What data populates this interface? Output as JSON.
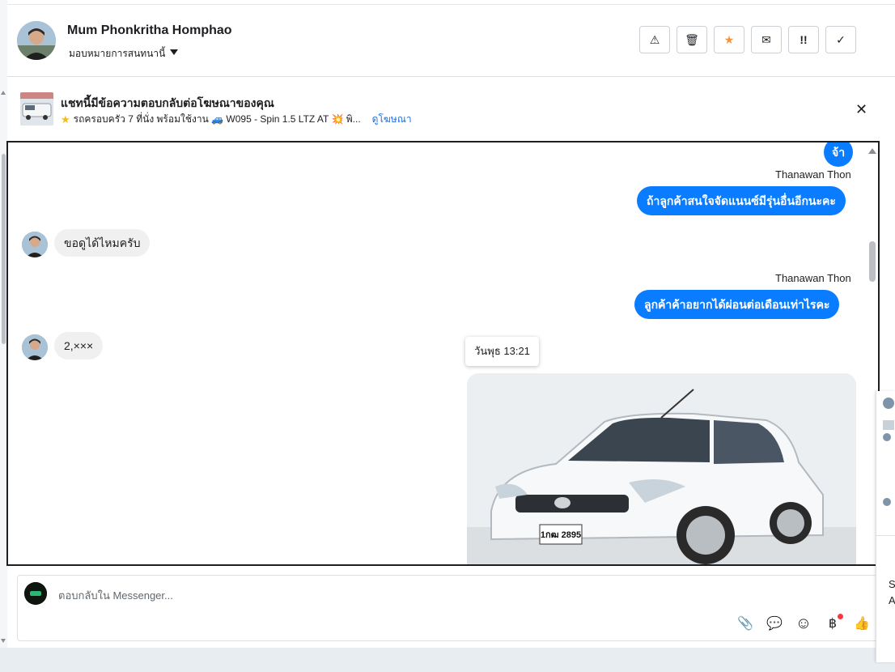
{
  "header": {
    "name": "Mum Phonkritha Homphao",
    "assign_label": "มอบหมายการสนทนานี้",
    "actions": [
      {
        "icon": "warning-icon",
        "glyph": "⚠"
      },
      {
        "icon": "trash-icon",
        "glyph": "🗑"
      },
      {
        "icon": "star-icon",
        "glyph": "★"
      },
      {
        "icon": "envelope-icon",
        "glyph": "✉"
      },
      {
        "icon": "follow-up-icon",
        "glyph": "!!"
      },
      {
        "icon": "check-icon",
        "glyph": "✓"
      }
    ]
  },
  "ad": {
    "title": "แชทนี้มีข้อความตอบกลับต่อโฆษณาของคุณ",
    "description": "รถครอบครัว 7 ที่นั่ง พร้อมใช้งาน 🚙 W095 - Spin 1.5 LTZ AT 💥 พิ...",
    "link": "ดูโฆษณา",
    "close_glyph": "✕"
  },
  "messages": {
    "out1": "จ้า",
    "sender1": "Thanawan Thon",
    "out2": "ถ้าลูกค้าสนใจจัดแนนซ์มีรุ่นอื่นอีกนะคะ",
    "in1": "ขอดูได้ไหมครับ",
    "sender2": "Thanawan Thon",
    "out3": "ลูกค้าค้าอยากได้ผ่อนต่อเดือนเท่าไรคะ",
    "in2": "2,×××",
    "tooltip": "วันพุธ 13:21",
    "plate": "1กฒ 2895"
  },
  "composer": {
    "placeholder": "ตอบกลับใน Messenger...",
    "tools": [
      {
        "icon": "paperclip-icon",
        "glyph": "📎"
      },
      {
        "icon": "saved-reply-icon",
        "glyph": "💬"
      },
      {
        "icon": "emoji-icon",
        "glyph": "☺"
      },
      {
        "icon": "payment-icon",
        "glyph": "฿"
      },
      {
        "icon": "thumbs-up-icon",
        "glyph": "👍"
      }
    ]
  },
  "right_panel": {
    "text1": "Se",
    "text2": "A"
  }
}
